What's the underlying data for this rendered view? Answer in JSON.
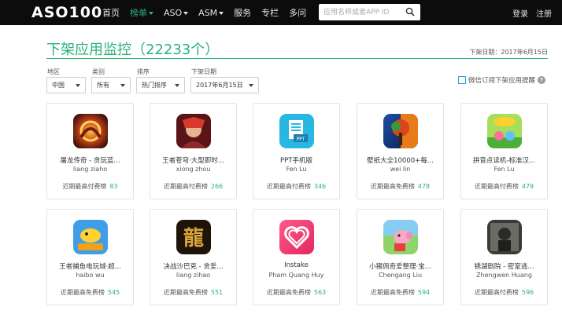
{
  "logo": "ASO100",
  "nav": {
    "items": [
      {
        "label": "首页",
        "dropdown": false,
        "active": false
      },
      {
        "label": "榜单",
        "dropdown": true,
        "active": true
      },
      {
        "label": "ASO",
        "dropdown": true,
        "active": false
      },
      {
        "label": "ASM",
        "dropdown": true,
        "active": false
      },
      {
        "label": "服务",
        "dropdown": false,
        "active": false
      },
      {
        "label": "专栏",
        "dropdown": false,
        "active": false
      },
      {
        "label": "多问",
        "dropdown": false,
        "active": false
      }
    ],
    "search_placeholder": "应用名称或者APP ID",
    "login": "登录",
    "register": "注册"
  },
  "page": {
    "title": "下架应用监控（22233个）",
    "delist_date": "下架日期：2017年6月15日"
  },
  "filters": {
    "region": {
      "label": "地区",
      "value": "中国"
    },
    "category": {
      "label": "类别",
      "value": "所有"
    },
    "sort": {
      "label": "排序",
      "value": "热门排序"
    },
    "date": {
      "label": "下架日期",
      "value": "2017年6月15日"
    },
    "wechat_subscribe": "微信订阅下架应用提醒",
    "help": "?"
  },
  "apps": [
    {
      "name": "屠龙传奇 - 贪玩蓝...",
      "developer": "liang ziaho",
      "rank_label": "近期最高付费榜",
      "rank": "83",
      "icon": "dragon-legend-icon"
    },
    {
      "name": "王者苍穹·大型即时...",
      "developer": "xiong zhou",
      "rank_label": "近期最高付费榜",
      "rank": "266",
      "icon": "warrior-icon"
    },
    {
      "name": "PPT手机版",
      "developer": "Fen Lu",
      "rank_label": "近期最高付费榜",
      "rank": "346",
      "icon": "ppt-icon"
    },
    {
      "name": "壁纸大全10000+每...",
      "developer": "wei lin",
      "rank_label": "近期最高免费榜",
      "rank": "478",
      "icon": "wallpaper-icon"
    },
    {
      "name": "拼音点读机-标准汉...",
      "developer": "Fen Lu",
      "rank_label": "近期最高付费榜",
      "rank": "479",
      "icon": "pinyin-icon"
    },
    {
      "name": "王者捕鱼电玩城·超...",
      "developer": "haibo wu",
      "rank_label": "近期最高免费榜",
      "rank": "545",
      "icon": "fishing-icon"
    },
    {
      "name": "决战沙巴克 - 贪爱...",
      "developer": "liang zihao",
      "rank_label": "近期最高免费榜",
      "rank": "551",
      "icon": "dragon-char-icon"
    },
    {
      "name": "Instake",
      "developer": "Pham Quang Huy",
      "rank_label": "近期最高免费榜",
      "rank": "563",
      "icon": "heart-icon"
    },
    {
      "name": "小猪佩奇爱整理·宝...",
      "developer": "Chengang Liu",
      "rank_label": "近期最高免费榜",
      "rank": "594",
      "icon": "peppa-icon"
    },
    {
      "name": "锈湖剧院 - 密室逃...",
      "developer": "Zhengwen Huang",
      "rank_label": "近期最高付费榜",
      "rank": "596",
      "icon": "rusty-lake-icon"
    }
  ],
  "colors": {
    "accent": "#2ab27b",
    "topbar": "#0c0c0c"
  }
}
